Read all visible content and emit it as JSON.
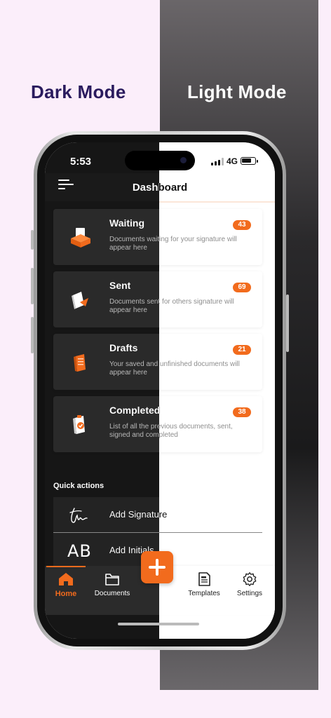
{
  "labels": {
    "dark": "Dark Mode",
    "light": "Light Mode"
  },
  "status": {
    "time": "5:53",
    "network": "4G"
  },
  "header": {
    "title": "Dashboard"
  },
  "cards": [
    {
      "title": "Waiting",
      "desc": "Documents waiting for your signature will appear here",
      "count": "43",
      "icon": "inbox-tray-icon"
    },
    {
      "title": "Sent",
      "desc": "Documents sent for others signature will appear here",
      "count": "69",
      "icon": "sent-document-icon"
    },
    {
      "title": "Drafts",
      "desc": "Your saved and unfinished documents will appear here",
      "count": "21",
      "icon": "draft-document-icon"
    },
    {
      "title": "Completed",
      "desc": "List of all the previous documents, sent, signed and completed",
      "count": "38",
      "icon": "completed-clipboard-icon"
    }
  ],
  "quick_actions": {
    "label": "Quick actions",
    "items": [
      {
        "label": "Add Signature",
        "icon": "signature-icon"
      },
      {
        "label": "Add Initials",
        "icon": "initials-icon",
        "glyph": "AB"
      }
    ]
  },
  "tabs": [
    {
      "label": "Home",
      "icon": "home-icon",
      "active": true
    },
    {
      "label": "Documents",
      "icon": "folder-icon"
    },
    {
      "label": "Templates",
      "icon": "template-document-icon"
    },
    {
      "label": "Settings",
      "icon": "gear-icon"
    }
  ],
  "colors": {
    "accent": "#f26b1d",
    "dark_label": "#2a1b5e",
    "dark_bg": "#161616",
    "card_dark": "#2a2a2a"
  }
}
